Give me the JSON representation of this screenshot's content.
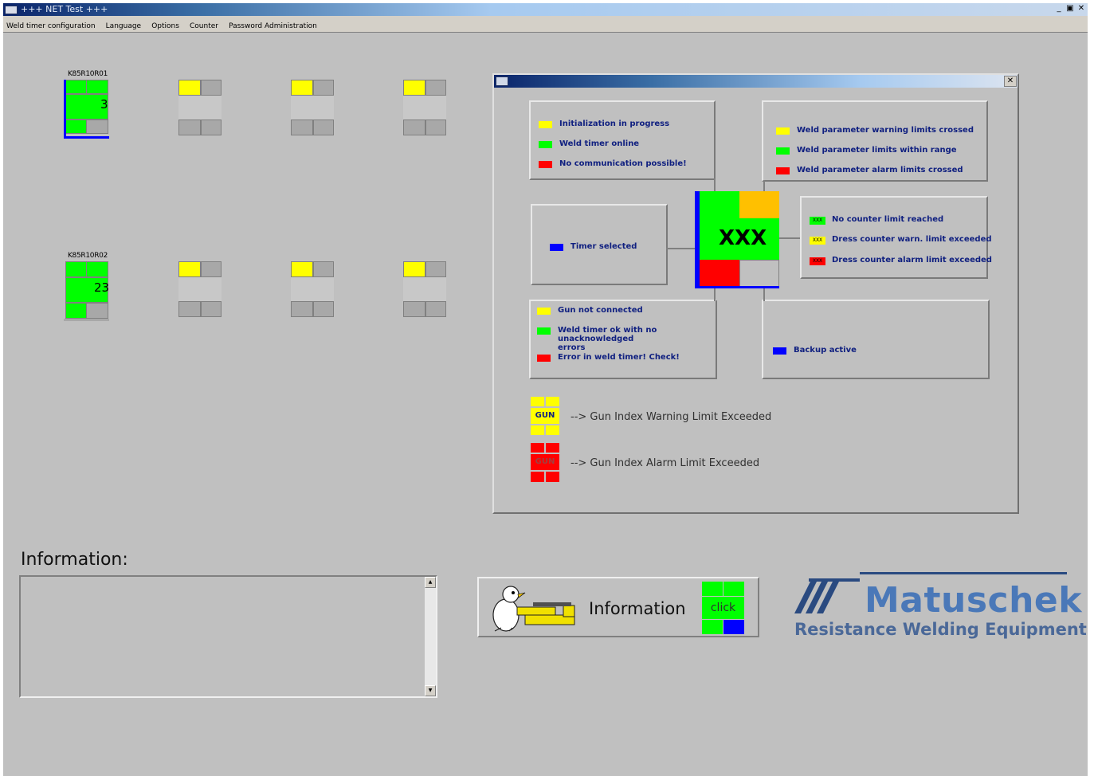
{
  "window": {
    "title": "+++ NET Test +++"
  },
  "menu": [
    "Weld timer configuration",
    "Language",
    "Options",
    "Counter",
    "Password Administration"
  ],
  "timers": [
    {
      "label": "K85R10R01",
      "value": "3"
    },
    {
      "label": "K85R10R02",
      "value": "23"
    }
  ],
  "legend": {
    "init": {
      "items": [
        {
          "color": "#ffff00",
          "text": "Initialization in progress"
        },
        {
          "color": "#00ff00",
          "text": "Weld timer online"
        },
        {
          "color": "#ff0000",
          "text": "No communication possible!"
        }
      ]
    },
    "params": {
      "items": [
        {
          "color": "#ffff00",
          "text": "Weld parameter warning limits crossed"
        },
        {
          "color": "#00ff00",
          "text": "Weld parameter limits within range"
        },
        {
          "color": "#ff0000",
          "text": "Weld parameter alarm limits crossed"
        }
      ]
    },
    "selected": {
      "color": "#0000ff",
      "text": "Timer selected"
    },
    "center_text": "XXX",
    "counter": {
      "chip_text": "XXX",
      "items": [
        {
          "color": "#00ff00",
          "text": "No counter limit reached"
        },
        {
          "color": "#ffff00",
          "text": "Dress counter warn. limit exceeded"
        },
        {
          "color": "#ff0000",
          "text": "Dress counter alarm limit exceeded"
        }
      ]
    },
    "gun": {
      "items": [
        {
          "color": "#ffff00",
          "text": "Gun not connected"
        },
        {
          "color": "#00ff00",
          "text": "Weld timer ok with no unacknowledged errors"
        },
        {
          "color": "#ff0000",
          "text": "Error in weld timer! Check!"
        }
      ]
    },
    "backup": {
      "color": "#0000ff",
      "text": "Backup active"
    },
    "gun_index": {
      "tile_text": "GUN",
      "warning": "--> Gun Index Warning Limit Exceeded",
      "alarm": "--> Gun Index Alarm Limit Exceeded"
    }
  },
  "info": {
    "label": "Information:"
  },
  "info_button": {
    "label": "Information",
    "click": "click"
  },
  "logo": {
    "name": "Matuschek",
    "tagline": "Resistance Welding Equipment"
  }
}
